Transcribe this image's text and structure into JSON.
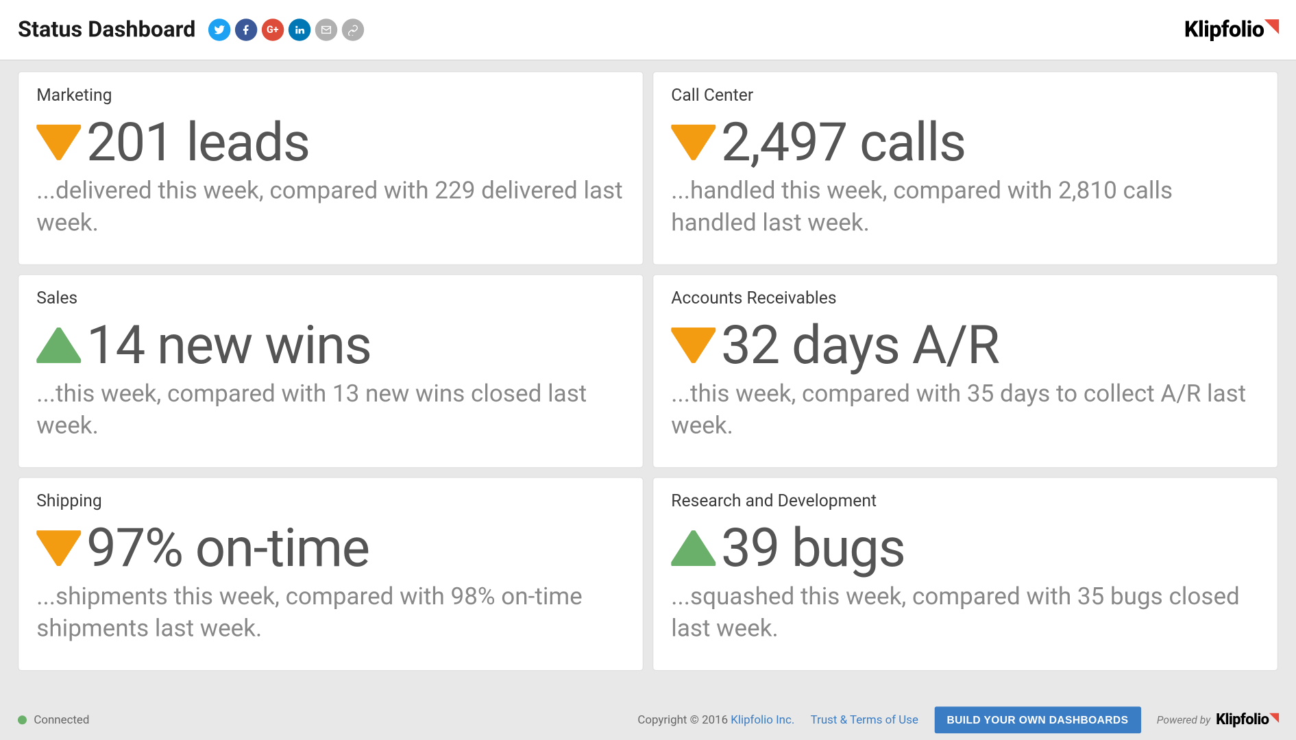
{
  "header": {
    "title": "Status Dashboard",
    "brand": "Klipfolio"
  },
  "cards": [
    {
      "title": "Marketing",
      "direction": "down",
      "metric": "201 leads",
      "desc": "...delivered this week, compared with 229 delivered last week."
    },
    {
      "title": "Call Center",
      "direction": "down",
      "metric": "2,497 calls",
      "desc": "...handled this week, compared with 2,810 calls handled last week."
    },
    {
      "title": "Sales",
      "direction": "up",
      "metric": "14 new wins",
      "desc": "...this week, compared with 13 new wins closed last week."
    },
    {
      "title": "Accounts Receivables",
      "direction": "down",
      "metric": "32 days A/R",
      "desc": "...this week, compared with 35 days to collect A/R last week."
    },
    {
      "title": "Shipping",
      "direction": "down",
      "metric": "97% on-time",
      "desc": "...shipments this week, compared with 98% on-time shipments last week."
    },
    {
      "title": "Research and Development",
      "direction": "up",
      "metric": "39 bugs",
      "desc": "...squashed this week, compared with 35 bugs closed last week."
    }
  ],
  "footer": {
    "status": "Connected",
    "copyright": "Copyright © 2016",
    "company_link": "Klipfolio Inc.",
    "terms_link": "Trust & Terms of Use",
    "cta": "BUILD YOUR OWN DASHBOARDS",
    "powered_by": "Powered by",
    "brand": "Klipfolio"
  }
}
